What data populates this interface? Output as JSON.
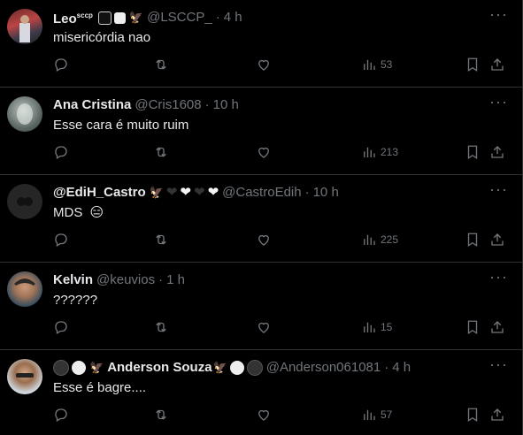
{
  "replies": [
    {
      "name": "Leo",
      "name_sup": "sccp",
      "handle": "@LSCCP_",
      "time": "4 h",
      "text": "misericórdia nao",
      "views": "53"
    },
    {
      "name": "Ana Cristina",
      "handle": "@Cris1608",
      "time": "10 h",
      "text": "Esse cara é muito ruim",
      "views": "213"
    },
    {
      "name": "@EdiH_Castro",
      "handle": "@CastroEdih",
      "time": "10 h",
      "text": "MDS",
      "views": "225"
    },
    {
      "name": "Kelvin",
      "handle": "@keuvios",
      "time": "1 h",
      "text": "??????",
      "views": "15"
    },
    {
      "name": "Anderson Souza",
      "handle": "@Anderson061081",
      "time": "4 h",
      "text": "Esse é bagre....",
      "views": "57"
    }
  ],
  "separator": "·",
  "more_glyph": "···",
  "colors": {
    "background": "#000000",
    "text": "#e7e9ea",
    "muted": "#71767b",
    "border": "#2f3336"
  }
}
